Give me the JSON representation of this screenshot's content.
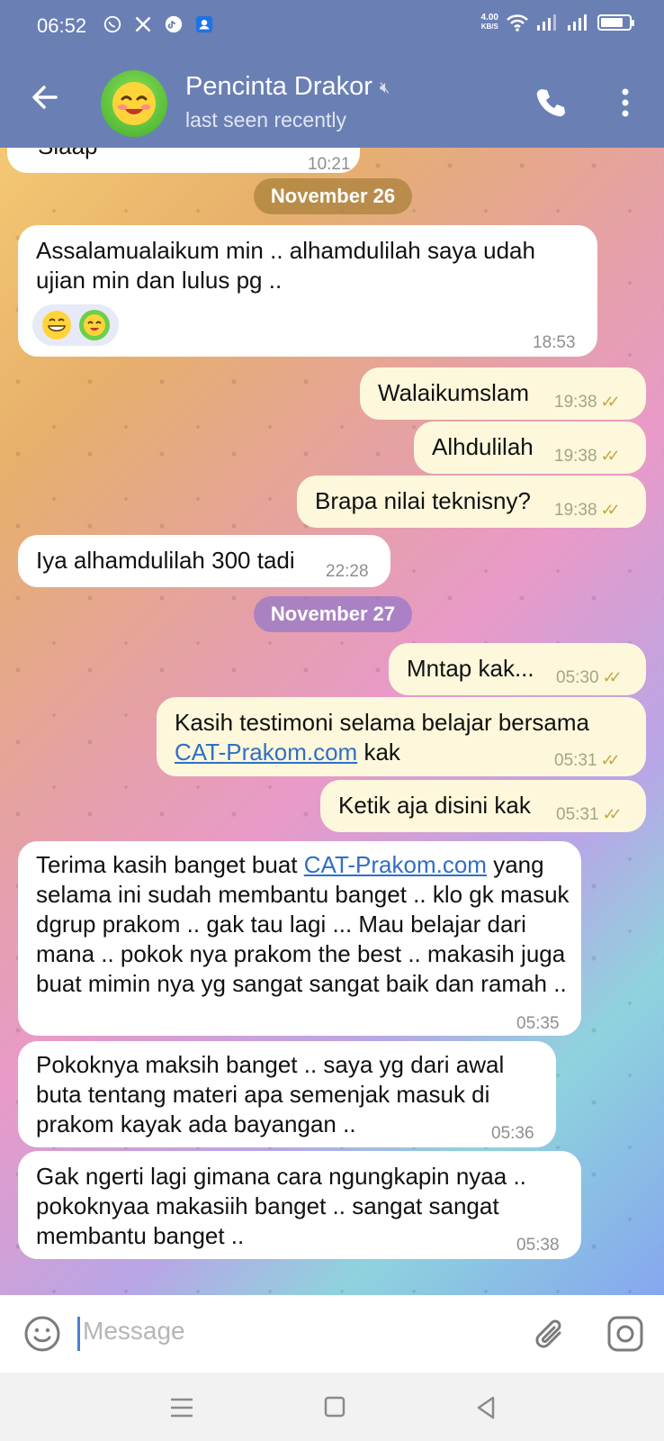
{
  "status_bar": {
    "time": "06:52",
    "net_speed_value": "4.00",
    "net_speed_unit": "KB/S",
    "app_icons": [
      "whatsapp-icon",
      "x-icon",
      "tiktok-icon",
      "contacts-icon"
    ],
    "battery_level": 0.8
  },
  "header": {
    "title": "Pencinta Drakor",
    "subtitle": "last seen recently",
    "muted_icon": "mute-icon",
    "background_color": "#6a7fb4"
  },
  "chat": {
    "partial_message": {
      "text": "Siaap",
      "time": "10:21"
    },
    "date_1": "November 26",
    "date_2": "November 27",
    "messages": [
      {
        "id": "m1",
        "direction": "incoming",
        "text": "Assalamualaikum min .. alhamdulilah saya udah ujian min dan lulus pg ..",
        "time": "18:53",
        "reactions": [
          "grin-emoji",
          "blush-emoji"
        ]
      },
      {
        "id": "m2",
        "direction": "outgoing",
        "text": "Walaikumslam",
        "time": "19:38",
        "status": "read"
      },
      {
        "id": "m3",
        "direction": "outgoing",
        "text": "Alhdulilah",
        "time": "19:38",
        "status": "read"
      },
      {
        "id": "m4",
        "direction": "outgoing",
        "text": "Brapa nilai teknisny?",
        "time": "19:38",
        "status": "read"
      },
      {
        "id": "m5",
        "direction": "incoming",
        "text": "Iya alhamdulilah 300 tadi",
        "time": "22:28"
      },
      {
        "id": "m6",
        "direction": "outgoing",
        "text": "Mntap kak...",
        "time": "05:30",
        "status": "read"
      },
      {
        "id": "m7",
        "direction": "outgoing",
        "text_before": "Kasih testimoni selama belajar bersama",
        "link": "CAT-Prakom.com",
        "text_after": "kak",
        "time": "05:31",
        "status": "read"
      },
      {
        "id": "m8",
        "direction": "outgoing",
        "text": "Ketik aja disini kak",
        "time": "05:31",
        "status": "read"
      },
      {
        "id": "m9",
        "direction": "incoming",
        "text_before": "Terima kasih banget buat",
        "link": "CAT-Prakom.com",
        "text_after": "yang selama ini sudah membantu banget .. klo gk masuk dgrup prakom .. gak tau lagi ... Mau belajar dari mana .. pokok nya prakom the best .. makasih juga buat mimin nya yg sangat sangat baik dan ramah ..",
        "time": "05:35"
      },
      {
        "id": "m10",
        "direction": "incoming",
        "text": "Pokoknya maksih banget .. saya yg dari awal buta tentang materi apa semenjak masuk di prakom kayak ada bayangan ..",
        "time": "05:36"
      },
      {
        "id": "m11",
        "direction": "incoming",
        "text": "Gak ngerti lagi gimana cara ngungkapin nyaa .. pokoknyaa makasiih banget .. sangat sangat membantu banget ..",
        "time": "05:38"
      }
    ]
  },
  "input": {
    "placeholder": "Message"
  },
  "colors": {
    "accent": "#6a7fb4",
    "link": "#2f6fc6",
    "outgoing_bubble": "#fdf8dc",
    "incoming_bubble": "#ffffff"
  }
}
